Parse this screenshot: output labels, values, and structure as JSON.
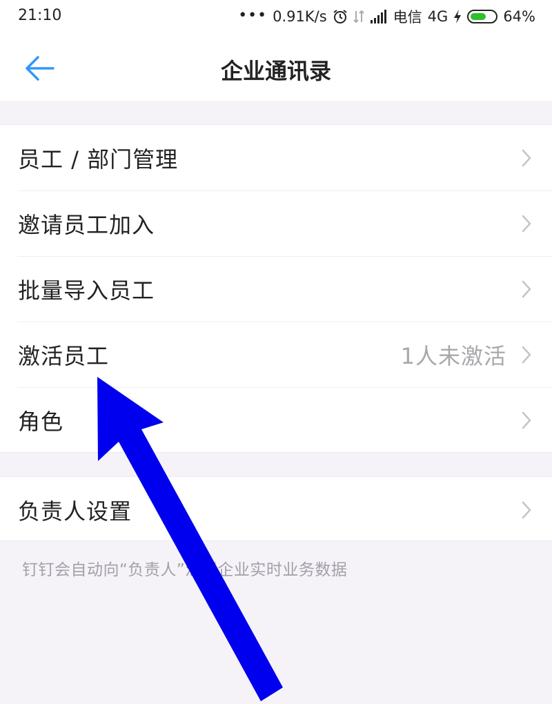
{
  "status_bar": {
    "time": "21:10",
    "network_speed": "0.91K/s",
    "carrier": "电信",
    "network_type": "4G",
    "battery": "64%",
    "battery_level": 0.64,
    "battery_color": "#2fbf2f"
  },
  "nav": {
    "title": "企业通讯录",
    "back_icon": "arrow-left-icon",
    "back_color": "#3296fa"
  },
  "group1": {
    "items": [
      {
        "label": "员工 / 部门管理",
        "value": ""
      },
      {
        "label": "邀请员工加入",
        "value": ""
      },
      {
        "label": "批量导入员工",
        "value": ""
      },
      {
        "label": "激活员工",
        "value": "1人未激活"
      },
      {
        "label": "角色",
        "value": ""
      }
    ]
  },
  "group2": {
    "items": [
      {
        "label": "负责人设置",
        "value": ""
      }
    ]
  },
  "footer": {
    "note": "钉钉会自动向“负责人”汇报企业实时业务数据"
  },
  "annotation": {
    "arrow_color": "#0000ee"
  }
}
